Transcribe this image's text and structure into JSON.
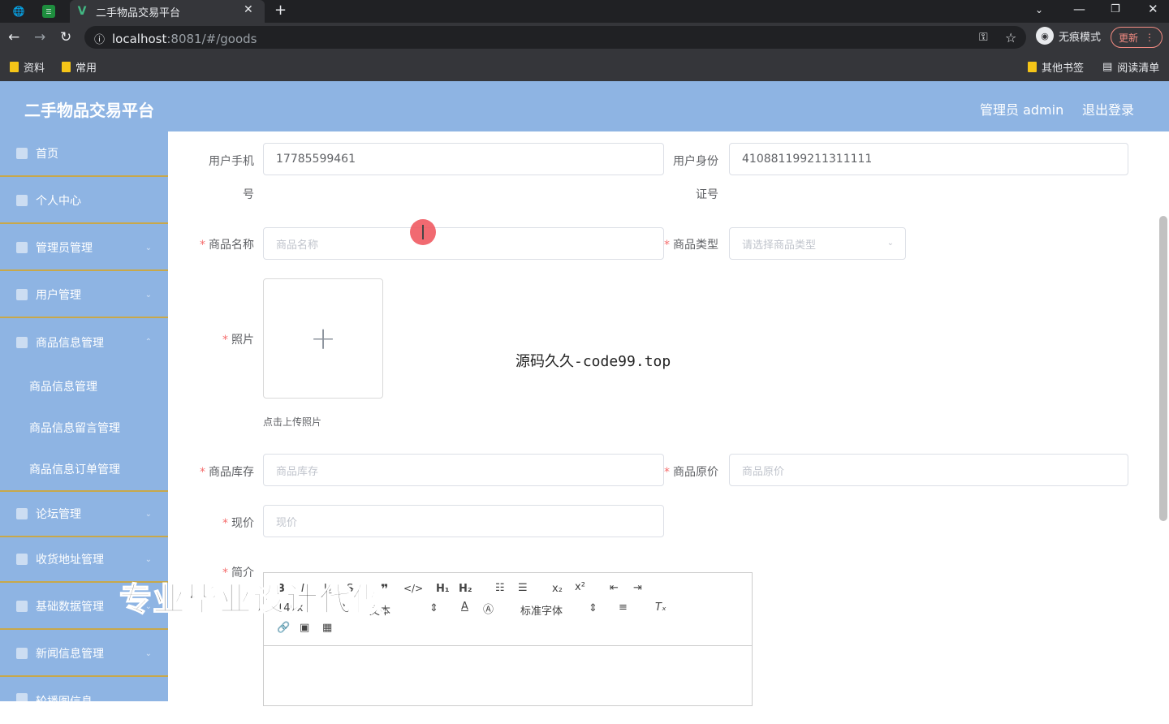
{
  "browser": {
    "tab_title": "二手物品交易平台",
    "url_host": "localhost",
    "url_rest": ":8081/#/goods",
    "incognito_label": "无痕模式",
    "update_label": "更新",
    "bookmarks": [
      "资料",
      "常用"
    ],
    "bookmarks_right": [
      "其他书签",
      "阅读清单"
    ]
  },
  "header": {
    "brand": "二手物品交易平台",
    "admin": "管理员 admin",
    "logout": "退出登录"
  },
  "sidebar": {
    "items": [
      {
        "label": "首页",
        "icon": "home-icon"
      },
      {
        "label": "个人中心",
        "icon": "user-icon"
      },
      {
        "label": "管理员管理",
        "icon": "admin-icon"
      },
      {
        "label": "用户管理",
        "icon": "users-icon"
      },
      {
        "label": "商品信息管理",
        "icon": "goods-icon"
      }
    ],
    "subitems": [
      "商品信息管理",
      "商品信息留言管理",
      "商品信息订单管理"
    ],
    "items2": [
      {
        "label": "论坛管理",
        "icon": "forum-icon"
      },
      {
        "label": "收货地址管理",
        "icon": "address-icon"
      },
      {
        "label": "基础数据管理",
        "icon": "data-icon"
      },
      {
        "label": "新闻信息管理",
        "icon": "news-icon"
      },
      {
        "label": "轮播图信息",
        "icon": "carousel-icon"
      }
    ]
  },
  "form": {
    "phone_label_1": "用户手机",
    "phone_label_2": "号",
    "phone_value": "17785599461",
    "id_label_1": "用户身份",
    "id_label_2": "证号",
    "id_value": "410881199211311111",
    "name_label": "商品名称",
    "name_placeholder": "商品名称",
    "type_label": "商品类型",
    "type_placeholder": "请选择商品类型",
    "photo_label": "照片",
    "upload_hint": "点击上传照片",
    "stock_label": "商品库存",
    "stock_placeholder": "商品库存",
    "orig_price_label": "商品原价",
    "orig_price_placeholder": "商品原价",
    "price_label": "现价",
    "price_placeholder": "现价",
    "intro_label": "简介",
    "editor": {
      "size": "14px",
      "text": "文本",
      "font": "标准字体"
    }
  },
  "overlays": {
    "caption": "源码久久-code99.top",
    "banner": "专业毕业设计代做"
  }
}
